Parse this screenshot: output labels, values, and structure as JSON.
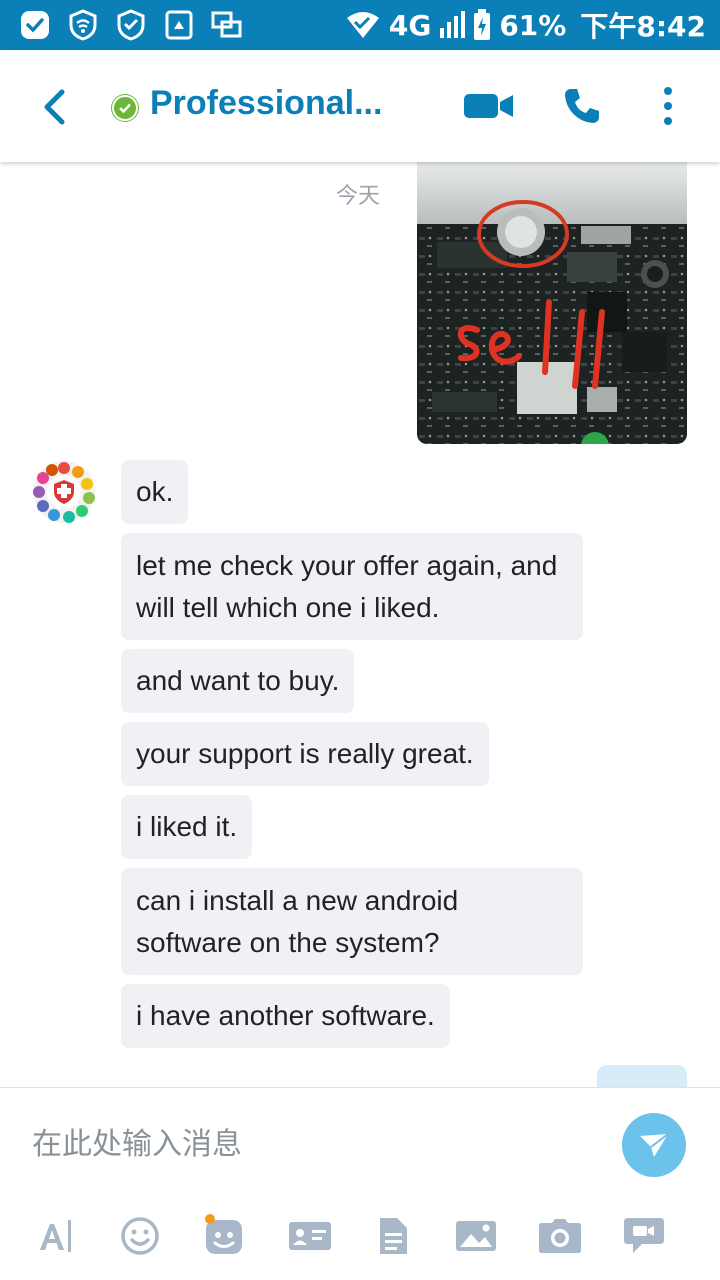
{
  "status_bar": {
    "network": "4G",
    "battery": "61%",
    "time": "下午8:42",
    "left_icons": [
      "messenger-icon",
      "wifi-shield-icon",
      "vpn-shield-icon",
      "storage-icon",
      "multiwindow-icon"
    ]
  },
  "header": {
    "title": "Professional...",
    "presence": "online",
    "actions": [
      "video-call-icon",
      "voice-call-icon",
      "more-options-icon"
    ]
  },
  "chat": {
    "date_label": "今天",
    "image_message": {
      "handwritten_text": "sell"
    },
    "messages": [
      "ok.",
      "let me check your offer again, and will tell which one i liked.",
      "and want to buy.",
      "your support is really great.",
      "i liked it.",
      "can i install a new android software on the system?",
      "i have another software."
    ]
  },
  "composer": {
    "placeholder": "在此处输入消息",
    "value": "",
    "tools": [
      "text-format-icon",
      "emoji-icon",
      "sticker-icon",
      "contact-card-icon",
      "file-icon",
      "gallery-icon",
      "camera-icon",
      "video-message-icon"
    ]
  },
  "colors": {
    "status_bar": "#0a7fb8",
    "accent": "#0a7fb8",
    "presence_online": "#6bb73a",
    "bubble_incoming": "#eff1f5",
    "send_button": "#6bc3ec",
    "tool_icon": "#a8b8c8"
  }
}
